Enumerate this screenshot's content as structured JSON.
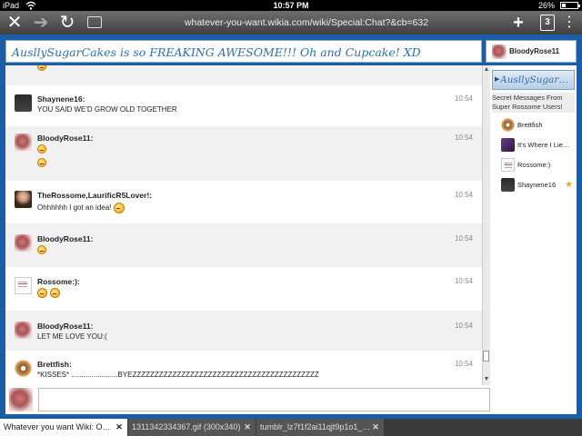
{
  "status": {
    "device": "iPad",
    "time": "10:57 PM",
    "battery": "26%",
    "battery_fraction": 0.26
  },
  "browser": {
    "url": "whatever-you-want.wikia.com/wiki/Special:Chat?&cb=632",
    "tab_count": "3"
  },
  "chat": {
    "title": "AusllySugarCakes is so FREAKING AWESOME!!! Oh and Cupcake! XD",
    "current_user": "BloodyRose11",
    "messages": [
      {
        "name": "Shaynene16:",
        "time": "10:54",
        "text": "YOU SAID WE'D GROW OLD TOGETHER"
      },
      {
        "name": "BloodyRose11:",
        "time": "10:54",
        "text": ""
      },
      {
        "name": "TheRossome,LaurificR5Lover!:",
        "time": "10:54",
        "text": "Ohhhhhh I got an idea!"
      },
      {
        "name": "BloodyRose11:",
        "time": "10:54",
        "text": ""
      },
      {
        "name": "Rossome:):",
        "time": "10:54",
        "text": ""
      },
      {
        "name": "BloodyRose11:",
        "time": "10:54",
        "text": "LET ME LOVE YOU:("
      },
      {
        "name": "Brettfish:",
        "time": "10:54",
        "text": "*KISSES* .......................BYEZZZZZZZZZZZZZZZZZZZZZZZZZZZZZZZZZZZZZZZZZZ"
      }
    ]
  },
  "sidebar": {
    "room_label": "AusllySugarCak...",
    "room_subtitle": "Secret Messages From Super Rossome Users!",
    "users": [
      {
        "name": "Brettfish"
      },
      {
        "name": "It's Where I Lie,..."
      },
      {
        "name": "Rossome:)"
      },
      {
        "name": "Shaynene16"
      }
    ]
  },
  "tabs": [
    {
      "title": "Whatever you want Wiki: Omg!..."
    },
    {
      "title": "1311342334367.gif (300x340)"
    },
    {
      "title": "tumblr_lz7f1f2ai11qjt9p1o1_50..."
    }
  ],
  "icons": {
    "close": "close-icon",
    "forward": "forward-arrow-icon",
    "reload": "reload-icon",
    "reader": "reader-icon",
    "add": "add-tab-icon",
    "menu": "menu-dots-icon"
  }
}
